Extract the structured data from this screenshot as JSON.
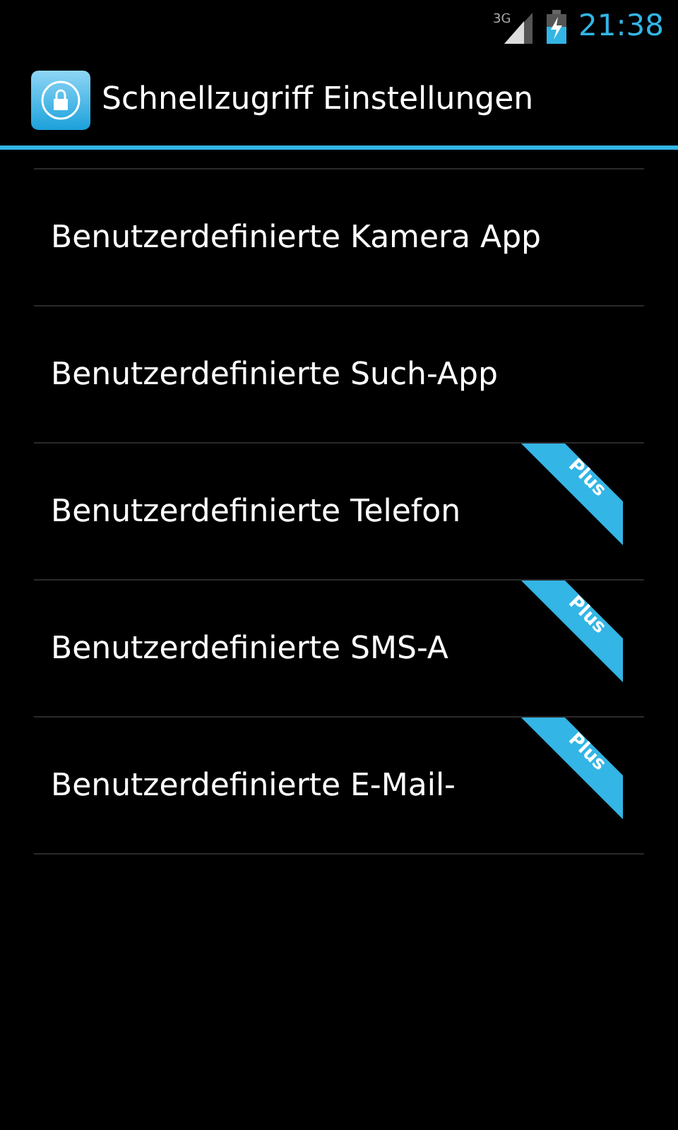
{
  "status_bar": {
    "network": "3G",
    "time": "21:38"
  },
  "action_bar": {
    "title": "Schnellzugriff Einstellungen"
  },
  "items": [
    {
      "label": "Benutzerdefinierte Kamera App",
      "plus": false
    },
    {
      "label": "Benutzerdefinierte Such-App",
      "plus": false
    },
    {
      "label": "Benutzerdefinierte Telefon",
      "plus": true,
      "ribbon": "Plus"
    },
    {
      "label": "Benutzerdefinierte SMS-A",
      "plus": true,
      "ribbon": "Plus"
    },
    {
      "label": "Benutzerdefinierte E-Mail-",
      "plus": true,
      "ribbon": "Plus"
    }
  ]
}
